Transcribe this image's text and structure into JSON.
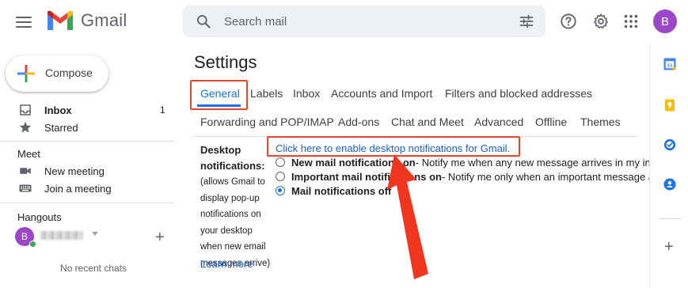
{
  "header": {
    "app_name": "Gmail",
    "search_placeholder": "Search mail",
    "avatar_letter": "B"
  },
  "sidebar": {
    "compose_label": "Compose",
    "items": [
      {
        "label": "Inbox",
        "count": "1"
      },
      {
        "label": "Starred"
      }
    ],
    "meet": {
      "title": "Meet",
      "items": [
        {
          "label": "New meeting"
        },
        {
          "label": "Join a meeting"
        }
      ]
    },
    "hangouts": {
      "title": "Hangouts",
      "avatar_letter": "B",
      "empty_text": "No recent chats"
    }
  },
  "settings": {
    "title": "Settings",
    "tabs_row1": [
      "General",
      "Labels",
      "Inbox",
      "Accounts and Import",
      "Filters and blocked addresses"
    ],
    "tabs_row2": [
      "Forwarding and POP/IMAP",
      "Add-ons",
      "Chat and Meet",
      "Advanced",
      "Offline",
      "Themes"
    ],
    "active_tab": "General",
    "desktop": {
      "label_title_1": "Desktop",
      "label_title_2": "notifications:",
      "desc_lines": [
        "(allows Gmail to",
        "display pop-up",
        "notifications on",
        "your desktop",
        "when new email",
        "messages arrive)"
      ],
      "learn_more": "Learn more",
      "enable_link": "Click here to enable desktop notifications for Gmail.",
      "options": [
        {
          "label": "New mail notifications on",
          "desc": " - Notify me when any new message arrives in my inbox",
          "checked": false
        },
        {
          "label": "Important mail notifications on",
          "desc": " - Notify me only when an important message arrives",
          "checked": false
        },
        {
          "label": "Mail notifications off",
          "desc": "",
          "checked": true
        }
      ]
    }
  },
  "colors": {
    "accent": "#1a73e8",
    "link": "#1a5fd2",
    "annotation": "#e8442e",
    "avatar": "#9c46c9"
  },
  "rail_icons": [
    "calendar-icon",
    "keep-icon",
    "tasks-icon",
    "contacts-icon"
  ]
}
